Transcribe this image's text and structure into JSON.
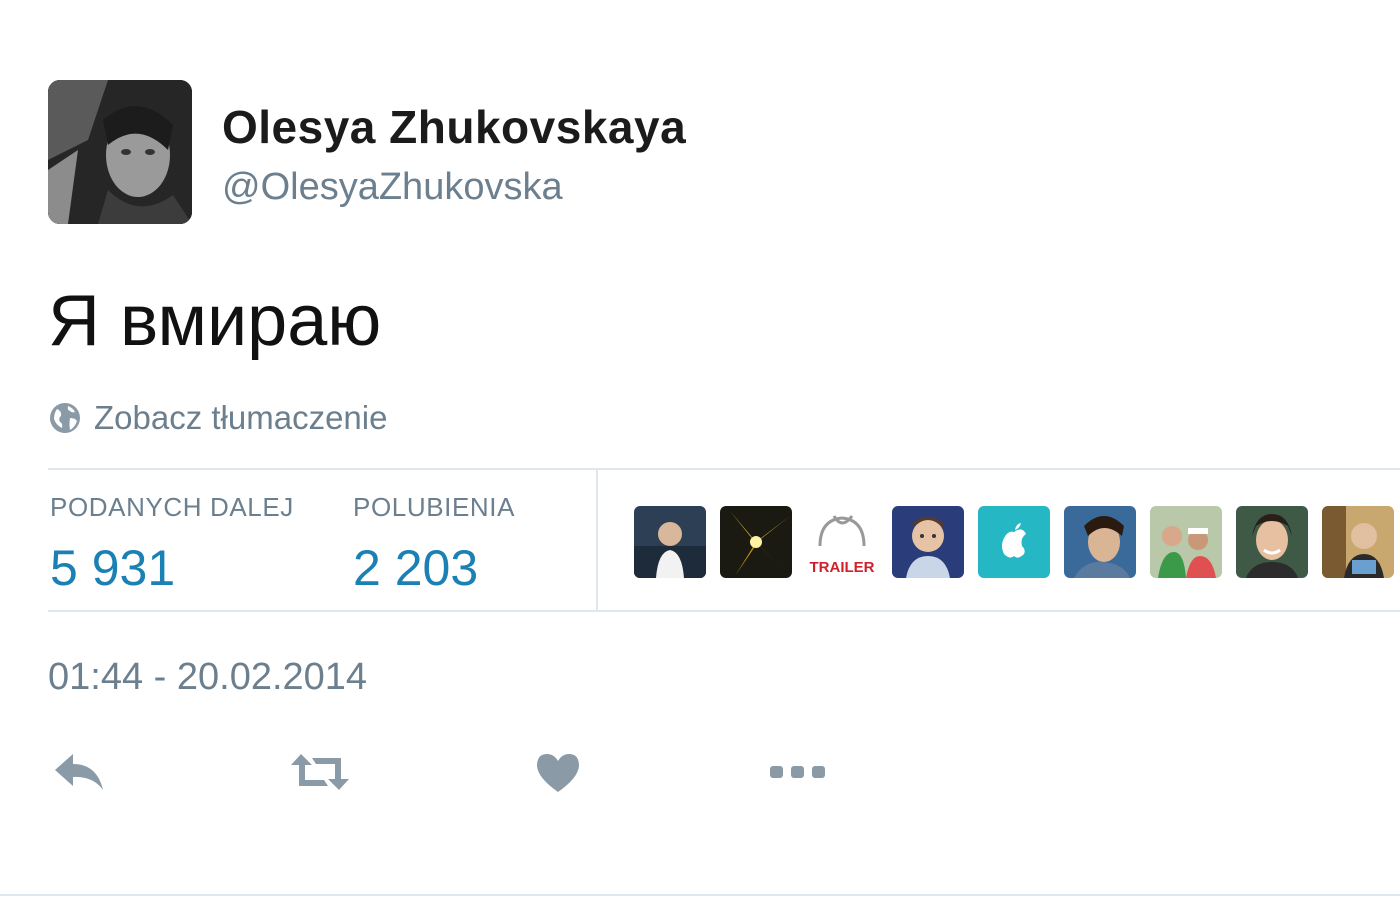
{
  "author": {
    "name": "Olesya Zhukovskaya",
    "handle": "@OlesyaZhukovska",
    "avatar_icon": "profile-photo"
  },
  "tweet": {
    "text": "Я вмираю",
    "translate_label": "Zobacz tłumaczenie",
    "translate_icon": "globe-icon"
  },
  "stats": {
    "retweets_label": "PODANYCH DALEJ",
    "retweets_value": "5 931",
    "likes_label": "POLUBIENIA",
    "likes_value": "2 203"
  },
  "likers": [
    {
      "icon": "liker-avatar-1"
    },
    {
      "icon": "liker-avatar-2"
    },
    {
      "icon": "liker-avatar-3",
      "text": "TRAILER"
    },
    {
      "icon": "liker-avatar-4"
    },
    {
      "icon": "liker-avatar-5"
    },
    {
      "icon": "liker-avatar-6"
    },
    {
      "icon": "liker-avatar-7"
    },
    {
      "icon": "liker-avatar-8"
    },
    {
      "icon": "liker-avatar-9"
    }
  ],
  "timestamp": "01:44 - 20.02.2014",
  "actions": {
    "reply_icon": "reply-icon",
    "retweet_icon": "retweet-icon",
    "like_icon": "heart-icon",
    "more_icon": "more-icon"
  },
  "colors": {
    "accent_blue": "#1b81b4",
    "muted_gray": "#6c7f8e",
    "icon_gray": "#8a9aa7",
    "divider": "#dfe7ec",
    "trailer_red": "#d0202a"
  }
}
